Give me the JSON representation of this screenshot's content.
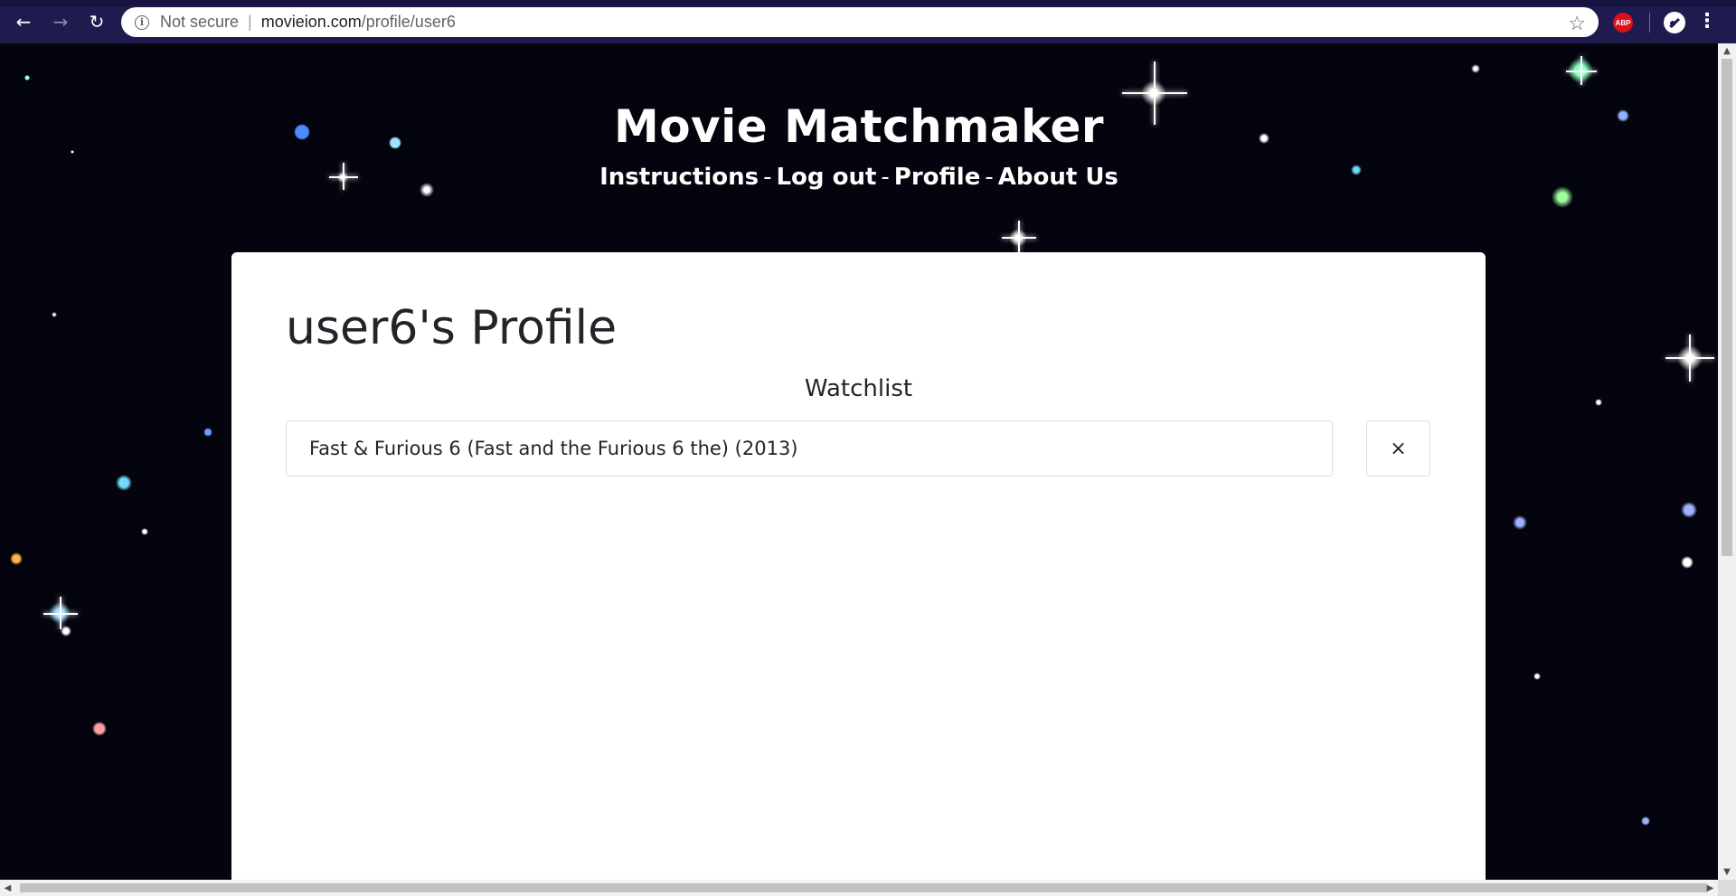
{
  "browser": {
    "back_icon": "←",
    "forward_icon": "→",
    "reload_icon": "↻",
    "info_icon": "i",
    "security_label": "Not secure",
    "separator": "|",
    "url_host": "movieion.com",
    "url_path": "/profile/user6",
    "bookmark_icon": "☆",
    "adblock_label": "ABP",
    "menu_icon": "⋮"
  },
  "site": {
    "title": "Movie Matchmaker",
    "nav": {
      "instructions": "Instructions",
      "logout": "Log out",
      "profile": "Profile",
      "about": "About Us",
      "separator": "-"
    }
  },
  "profile": {
    "title": "user6's Profile",
    "watchlist_heading": "Watchlist",
    "watchlist": [
      {
        "title": "Fast & Furious 6 (Fast and the Furious 6 the) (2013)",
        "remove_label": "×"
      }
    ]
  },
  "scrollbar": {
    "up_arrow": "▲",
    "down_arrow": "▼",
    "left_arrow": "◀",
    "right_arrow": "▶"
  }
}
